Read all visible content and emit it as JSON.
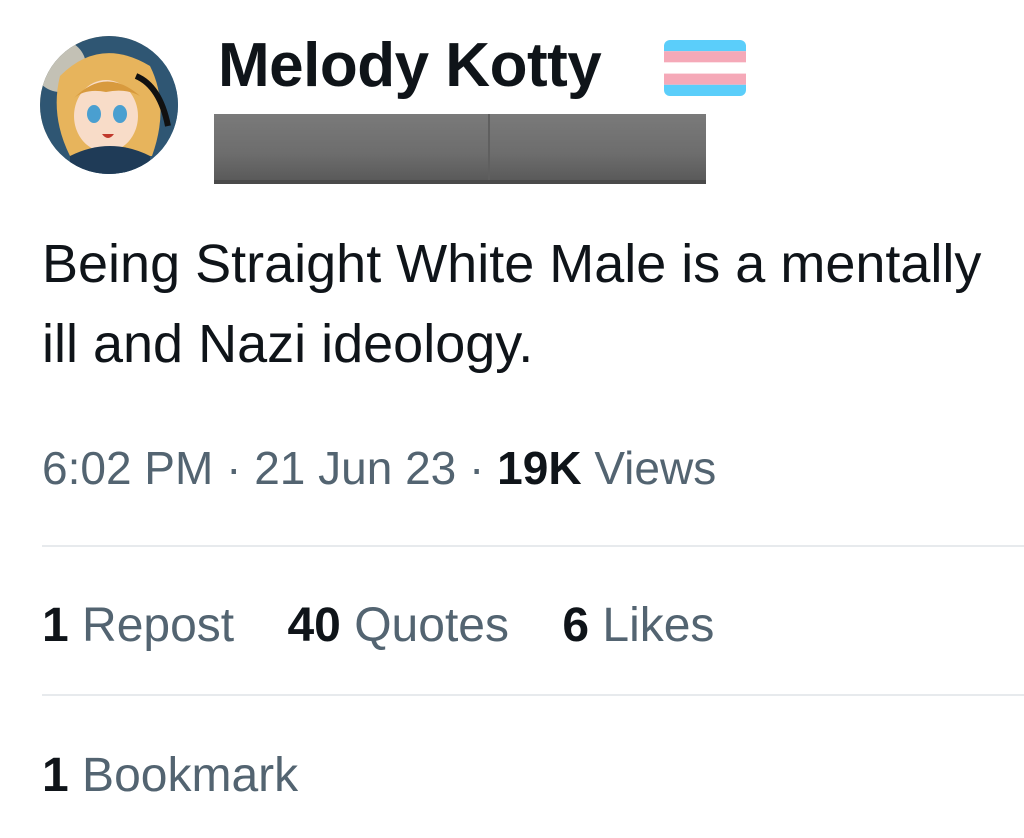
{
  "author": {
    "display_name": "Melody Kotty",
    "avatar_icon": "anime-avatar",
    "badge_icon": "transgender-flag-icon",
    "badge_colors": [
      "#5BCEFA",
      "#F5A9B8",
      "#FFFFFF",
      "#F5A9B8",
      "#5BCEFA"
    ]
  },
  "tweet": {
    "text": "Being Straight White Male is a mentally ill and Nazi ideology."
  },
  "meta": {
    "time": "6:02 PM",
    "separator": "·",
    "date": "21 Jun 23",
    "views_count": "19K",
    "views_label": "Views"
  },
  "stats": {
    "reposts_count": "1",
    "reposts_label": "Repost",
    "quotes_count": "40",
    "quotes_label": "Quotes",
    "likes_count": "6",
    "likes_label": "Likes",
    "bookmarks_count": "1",
    "bookmarks_label": "Bookmark"
  }
}
